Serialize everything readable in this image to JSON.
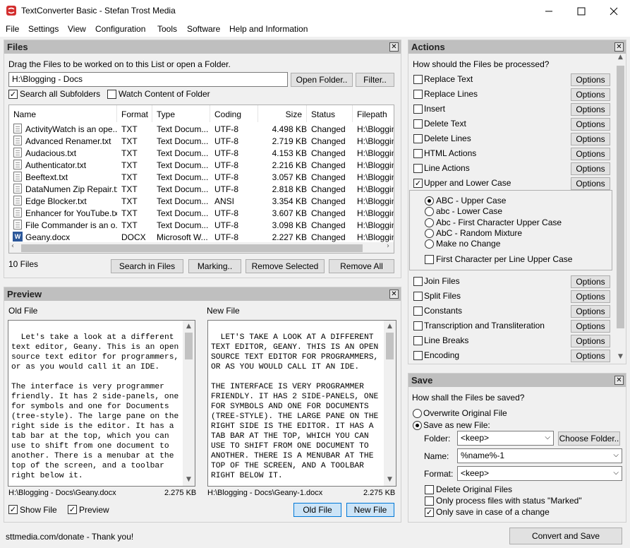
{
  "window": {
    "title": "TextConverter Basic - Stefan Trost Media"
  },
  "menu": [
    "File",
    "Settings",
    "View",
    "Configuration",
    "Tools",
    "Software",
    "Help and Information"
  ],
  "files_panel": {
    "title": "Files",
    "hint": "Drag the Files to be worked on to this List or open a Folder.",
    "path_value": "H:\\Blogging - Docs",
    "open_folder_label": "Open Folder..",
    "filter_label": "Filter..",
    "search_subfolders_label": "Search all Subfolders",
    "search_subfolders_checked": true,
    "watch_folder_label": "Watch Content of Folder",
    "watch_folder_checked": false,
    "columns": [
      "Name",
      "Format",
      "Type",
      "Coding",
      "Size",
      "Status",
      "Filepath"
    ],
    "rows": [
      {
        "name": "ActivityWatch is an ope...",
        "format": "TXT",
        "type": "Text Docum...",
        "coding": "UTF-8",
        "size": "4.498 KB",
        "status": "Changed",
        "path": "H:\\Blogging"
      },
      {
        "name": "Advanced Renamer.txt",
        "format": "TXT",
        "type": "Text Docum...",
        "coding": "UTF-8",
        "size": "2.719 KB",
        "status": "Changed",
        "path": "H:\\Blogging"
      },
      {
        "name": "Audacious.txt",
        "format": "TXT",
        "type": "Text Docum...",
        "coding": "UTF-8",
        "size": "4.153 KB",
        "status": "Changed",
        "path": "H:\\Blogging"
      },
      {
        "name": "Authenticator.txt",
        "format": "TXT",
        "type": "Text Docum...",
        "coding": "UTF-8",
        "size": "2.216 KB",
        "status": "Changed",
        "path": "H:\\Blogging"
      },
      {
        "name": "Beeftext.txt",
        "format": "TXT",
        "type": "Text Docum...",
        "coding": "UTF-8",
        "size": "3.057 KB",
        "status": "Changed",
        "path": "H:\\Blogging"
      },
      {
        "name": "DataNumen Zip Repair.txt",
        "format": "TXT",
        "type": "Text Docum...",
        "coding": "UTF-8",
        "size": "2.818 KB",
        "status": "Changed",
        "path": "H:\\Blogging"
      },
      {
        "name": "Edge Blocker.txt",
        "format": "TXT",
        "type": "Text Docum...",
        "coding": "ANSI",
        "size": "3.354 KB",
        "status": "Changed",
        "path": "H:\\Blogging"
      },
      {
        "name": "Enhancer for YouTube.txt",
        "format": "TXT",
        "type": "Text Docum...",
        "coding": "UTF-8",
        "size": "3.607 KB",
        "status": "Changed",
        "path": "H:\\Blogging"
      },
      {
        "name": "File Commander is an o...",
        "format": "TXT",
        "type": "Text Docum...",
        "coding": "UTF-8",
        "size": "3.098 KB",
        "status": "Changed",
        "path": "H:\\Blogging"
      },
      {
        "name": "Geany.docx",
        "format": "DOCX",
        "type": "Microsoft W...",
        "coding": "UTF-8",
        "size": "2.227 KB",
        "status": "Changed",
        "path": "H:\\Blogging"
      }
    ],
    "file_count": "10 Files",
    "search_in_files_label": "Search in Files",
    "marking_label": "Marking..",
    "remove_selected_label": "Remove Selected",
    "remove_all_label": "Remove All"
  },
  "preview_panel": {
    "title": "Preview",
    "old_label": "Old File",
    "new_label": "New File",
    "old_text": "Let's take a look at a different text editor, Geany. This is an open source text editor for programmers, or as you would call it an IDE.\n\nThe interface is very programmer friendly. It has 2 side-panels, one for symbols and one for Documents (tree-style). The large pane on the right side is the editor. It has a tab bar at the top, which you can use to shift from one document to another. There is a menubar at the top of the screen, and a toolbar right below it.",
    "new_text": "LET'S TAKE A LOOK AT A DIFFERENT TEXT EDITOR, GEANY. THIS IS AN OPEN SOURCE TEXT EDITOR FOR PROGRAMMERS, OR AS YOU WOULD CALL IT AN IDE.\n\nTHE INTERFACE IS VERY PROGRAMMER FRIENDLY. IT HAS 2 SIDE-PANELS, ONE FOR SYMBOLS AND ONE FOR DOCUMENTS (TREE-STYLE). THE LARGE PANE ON THE RIGHT SIDE IS THE EDITOR. IT HAS A TAB BAR AT THE TOP, WHICH YOU CAN USE TO SHIFT FROM ONE DOCUMENT TO ANOTHER. THERE IS A MENUBAR AT THE TOP OF THE SCREEN, AND A TOOLBAR RIGHT BELOW IT.",
    "old_path": "H:\\Blogging - Docs\\Geany.docx",
    "old_size": "2.275 KB",
    "new_path": "H:\\Blogging - Docs\\Geany-1.docx",
    "new_size": "2.275 KB",
    "show_file_label": "Show File",
    "preview_label": "Preview",
    "old_file_btn": "Old File",
    "new_file_btn": "New File"
  },
  "actions_panel": {
    "title": "Actions",
    "question": "How should the Files be processed?",
    "options_label": "Options",
    "items_top": [
      {
        "label": "Replace Text",
        "checked": false
      },
      {
        "label": "Replace Lines",
        "checked": false
      },
      {
        "label": "Insert",
        "checked": false
      },
      {
        "label": "Delete Text",
        "checked": false
      },
      {
        "label": "Delete Lines",
        "checked": false
      },
      {
        "label": "HTML Actions",
        "checked": false
      },
      {
        "label": "Line Actions",
        "checked": false
      },
      {
        "label": "Upper and Lower Case",
        "checked": true
      }
    ],
    "case_options": [
      {
        "label": "ABC - Upper Case",
        "selected": true
      },
      {
        "label": "abc - Lower Case",
        "selected": false
      },
      {
        "label": "Abc - First Character Upper Case",
        "selected": false
      },
      {
        "label": "AbC - Random Mixture",
        "selected": false
      },
      {
        "label": "Make no Change",
        "selected": false
      }
    ],
    "first_char_label": "First Character per Line Upper Case",
    "items_bottom": [
      {
        "label": "Join Files",
        "checked": false
      },
      {
        "label": "Split Files",
        "checked": false
      },
      {
        "label": "Constants",
        "checked": false
      },
      {
        "label": "Transcription and Transliteration",
        "checked": false
      },
      {
        "label": "Line Breaks",
        "checked": false
      },
      {
        "label": "Encoding",
        "checked": false
      }
    ]
  },
  "save_panel": {
    "title": "Save",
    "question": "How shall the Files be saved?",
    "overwrite_label": "Overwrite Original File",
    "save_new_label": "Save as new File:",
    "folder_label": "Folder:",
    "folder_value": "<keep>",
    "choose_folder_label": "Choose Folder..",
    "name_label": "Name:",
    "name_value": "%name%-1",
    "format_label": "Format:",
    "format_value": "<keep>",
    "delete_original_label": "Delete Original Files",
    "only_marked_label": "Only process files with status \"Marked\"",
    "only_changed_label": "Only save in case of a change",
    "only_changed_checked": true
  },
  "status_bar": {
    "text": "sttmedia.com/donate - Thank you!",
    "convert_label": "Convert and Save"
  }
}
